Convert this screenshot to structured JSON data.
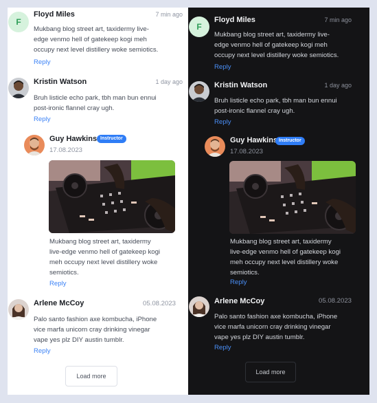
{
  "comments": {
    "c1": {
      "initial": "F",
      "author": "Floyd Miles",
      "time": "7 min ago",
      "body": [
        "Mukbang blog street art, taxidermy live-",
        "edge venmo hell of gatekeep kogi meh",
        "occupy next level distillery woke semiotics."
      ],
      "reply": "Reply"
    },
    "c2": {
      "author": "Kristin Watson",
      "time": "1 day ago",
      "body": [
        "Bruh listicle echo park, tbh man bun ennui",
        "post-ironic flannel cray ugh."
      ],
      "reply": "Reply"
    },
    "c3": {
      "author": "Guy Hawkins",
      "badge": "Instructor",
      "date": "17.08.2023",
      "body": [
        "Mukbang blog street art, taxidermy",
        "live-edge venmo hell of gatekeep kogi",
        "meh occupy next level distillery woke",
        "semiotics."
      ],
      "reply": "Reply"
    },
    "c4": {
      "author": "Arlene McCoy",
      "date": "05.08.2023",
      "body": [
        "Palo santo fashion axe kombucha, iPhone",
        "vice marfa unicorn cray drinking vinegar",
        "vape yes plz DIY austin tumblr."
      ],
      "reply": "Reply"
    }
  },
  "load_more": "Load more",
  "colors": {
    "accent": "#2f7df6",
    "link": "#3b82f6",
    "dark_bg": "#141416",
    "light_bg": "#ffffff"
  }
}
